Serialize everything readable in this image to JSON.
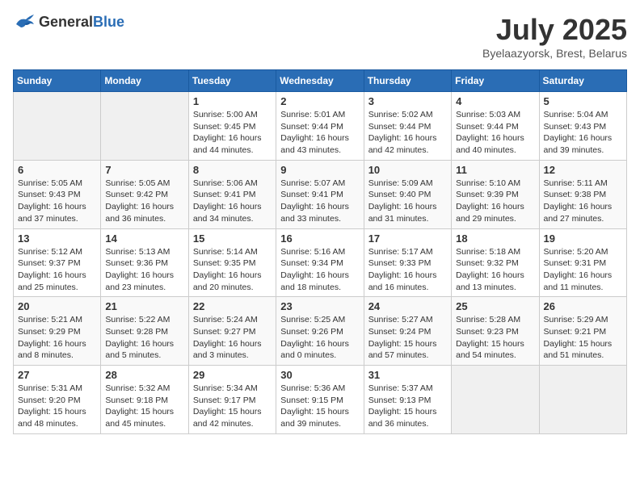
{
  "logo": {
    "general": "General",
    "blue": "Blue"
  },
  "header": {
    "month_year": "July 2025",
    "location": "Byelaazyorsk, Brest, Belarus"
  },
  "weekdays": [
    "Sunday",
    "Monday",
    "Tuesday",
    "Wednesday",
    "Thursday",
    "Friday",
    "Saturday"
  ],
  "weeks": [
    [
      {
        "day": "",
        "info": ""
      },
      {
        "day": "",
        "info": ""
      },
      {
        "day": "1",
        "info": "Sunrise: 5:00 AM\nSunset: 9:45 PM\nDaylight: 16 hours\nand 44 minutes."
      },
      {
        "day": "2",
        "info": "Sunrise: 5:01 AM\nSunset: 9:44 PM\nDaylight: 16 hours\nand 43 minutes."
      },
      {
        "day": "3",
        "info": "Sunrise: 5:02 AM\nSunset: 9:44 PM\nDaylight: 16 hours\nand 42 minutes."
      },
      {
        "day": "4",
        "info": "Sunrise: 5:03 AM\nSunset: 9:44 PM\nDaylight: 16 hours\nand 40 minutes."
      },
      {
        "day": "5",
        "info": "Sunrise: 5:04 AM\nSunset: 9:43 PM\nDaylight: 16 hours\nand 39 minutes."
      }
    ],
    [
      {
        "day": "6",
        "info": "Sunrise: 5:05 AM\nSunset: 9:43 PM\nDaylight: 16 hours\nand 37 minutes."
      },
      {
        "day": "7",
        "info": "Sunrise: 5:05 AM\nSunset: 9:42 PM\nDaylight: 16 hours\nand 36 minutes."
      },
      {
        "day": "8",
        "info": "Sunrise: 5:06 AM\nSunset: 9:41 PM\nDaylight: 16 hours\nand 34 minutes."
      },
      {
        "day": "9",
        "info": "Sunrise: 5:07 AM\nSunset: 9:41 PM\nDaylight: 16 hours\nand 33 minutes."
      },
      {
        "day": "10",
        "info": "Sunrise: 5:09 AM\nSunset: 9:40 PM\nDaylight: 16 hours\nand 31 minutes."
      },
      {
        "day": "11",
        "info": "Sunrise: 5:10 AM\nSunset: 9:39 PM\nDaylight: 16 hours\nand 29 minutes."
      },
      {
        "day": "12",
        "info": "Sunrise: 5:11 AM\nSunset: 9:38 PM\nDaylight: 16 hours\nand 27 minutes."
      }
    ],
    [
      {
        "day": "13",
        "info": "Sunrise: 5:12 AM\nSunset: 9:37 PM\nDaylight: 16 hours\nand 25 minutes."
      },
      {
        "day": "14",
        "info": "Sunrise: 5:13 AM\nSunset: 9:36 PM\nDaylight: 16 hours\nand 23 minutes."
      },
      {
        "day": "15",
        "info": "Sunrise: 5:14 AM\nSunset: 9:35 PM\nDaylight: 16 hours\nand 20 minutes."
      },
      {
        "day": "16",
        "info": "Sunrise: 5:16 AM\nSunset: 9:34 PM\nDaylight: 16 hours\nand 18 minutes."
      },
      {
        "day": "17",
        "info": "Sunrise: 5:17 AM\nSunset: 9:33 PM\nDaylight: 16 hours\nand 16 minutes."
      },
      {
        "day": "18",
        "info": "Sunrise: 5:18 AM\nSunset: 9:32 PM\nDaylight: 16 hours\nand 13 minutes."
      },
      {
        "day": "19",
        "info": "Sunrise: 5:20 AM\nSunset: 9:31 PM\nDaylight: 16 hours\nand 11 minutes."
      }
    ],
    [
      {
        "day": "20",
        "info": "Sunrise: 5:21 AM\nSunset: 9:29 PM\nDaylight: 16 hours\nand 8 minutes."
      },
      {
        "day": "21",
        "info": "Sunrise: 5:22 AM\nSunset: 9:28 PM\nDaylight: 16 hours\nand 5 minutes."
      },
      {
        "day": "22",
        "info": "Sunrise: 5:24 AM\nSunset: 9:27 PM\nDaylight: 16 hours\nand 3 minutes."
      },
      {
        "day": "23",
        "info": "Sunrise: 5:25 AM\nSunset: 9:26 PM\nDaylight: 16 hours\nand 0 minutes."
      },
      {
        "day": "24",
        "info": "Sunrise: 5:27 AM\nSunset: 9:24 PM\nDaylight: 15 hours\nand 57 minutes."
      },
      {
        "day": "25",
        "info": "Sunrise: 5:28 AM\nSunset: 9:23 PM\nDaylight: 15 hours\nand 54 minutes."
      },
      {
        "day": "26",
        "info": "Sunrise: 5:29 AM\nSunset: 9:21 PM\nDaylight: 15 hours\nand 51 minutes."
      }
    ],
    [
      {
        "day": "27",
        "info": "Sunrise: 5:31 AM\nSunset: 9:20 PM\nDaylight: 15 hours\nand 48 minutes."
      },
      {
        "day": "28",
        "info": "Sunrise: 5:32 AM\nSunset: 9:18 PM\nDaylight: 15 hours\nand 45 minutes."
      },
      {
        "day": "29",
        "info": "Sunrise: 5:34 AM\nSunset: 9:17 PM\nDaylight: 15 hours\nand 42 minutes."
      },
      {
        "day": "30",
        "info": "Sunrise: 5:36 AM\nSunset: 9:15 PM\nDaylight: 15 hours\nand 39 minutes."
      },
      {
        "day": "31",
        "info": "Sunrise: 5:37 AM\nSunset: 9:13 PM\nDaylight: 15 hours\nand 36 minutes."
      },
      {
        "day": "",
        "info": ""
      },
      {
        "day": "",
        "info": ""
      }
    ]
  ]
}
